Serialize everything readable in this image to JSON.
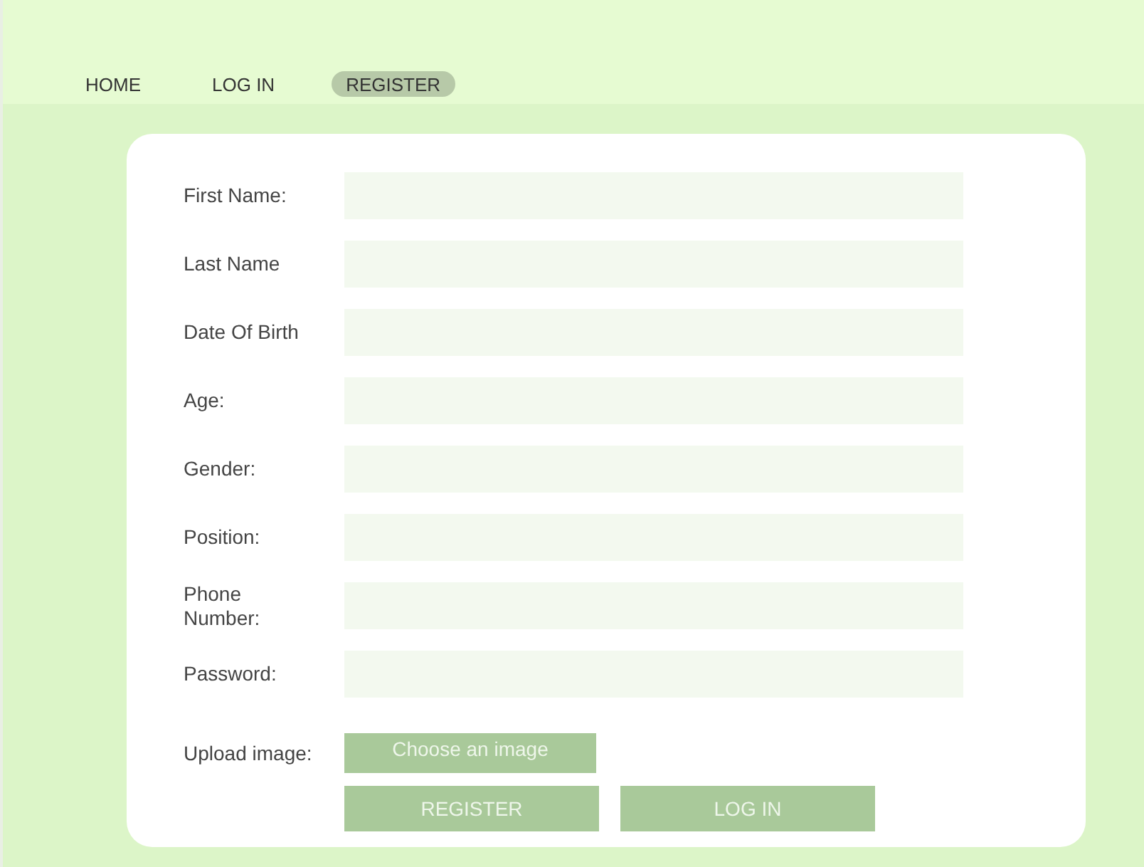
{
  "nav": [
    {
      "label": "HOME",
      "selected": false
    },
    {
      "label": "LOG IN",
      "selected": false
    },
    {
      "label": "REGISTER",
      "selected": true
    }
  ],
  "form": {
    "fields": [
      {
        "label": "First Name:"
      },
      {
        "label": "Last Name"
      },
      {
        "label": "Date Of Birth"
      },
      {
        "label": "Age:"
      },
      {
        "label": "Gender:"
      },
      {
        "label": "Position:"
      },
      {
        "label": "Phone Number:"
      },
      {
        "label": "Password:"
      }
    ],
    "upload": {
      "label": "Upload image:",
      "button": "Choose an image"
    },
    "buttons": [
      "REGISTER",
      "LOG IN"
    ]
  }
}
